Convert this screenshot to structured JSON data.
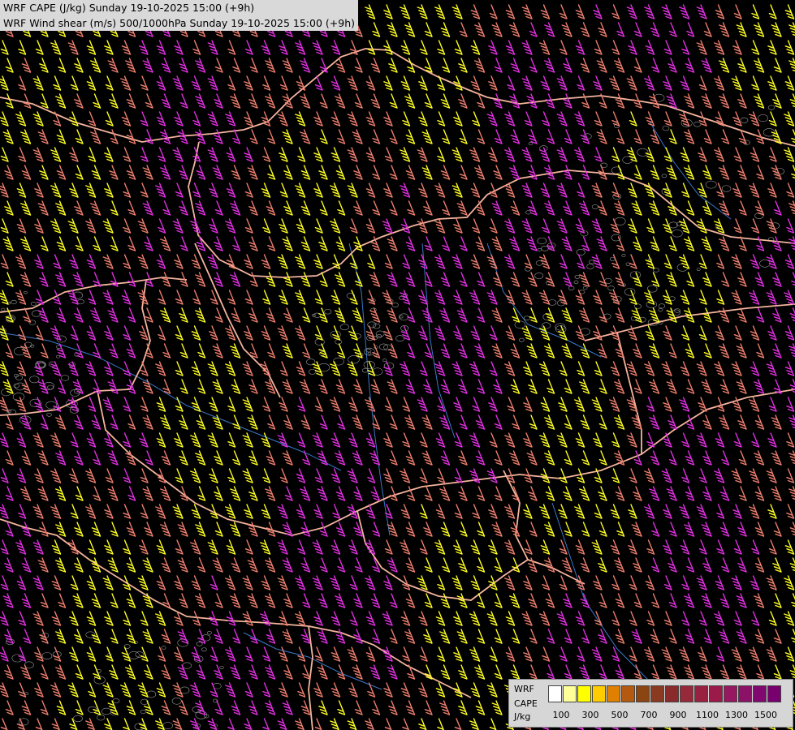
{
  "titles": {
    "cape": "WRF CAPE (J/kg) Sunday 19-10-2025 15:00 (+9h)",
    "shear": "WRF Wind shear (m/s) 500/1000hPa Sunday 19-10-2025 15:00 (+9h)"
  },
  "legend": {
    "line1": "WRF",
    "line2": "CAPE",
    "line3": "J/kg",
    "ticks": [
      "100",
      "300",
      "500",
      "700",
      "900",
      "1100",
      "1300",
      "1500"
    ],
    "swatch_colors": [
      "#ffffff",
      "#ffff99",
      "#ffff00",
      "#ffcc00",
      "#e08000",
      "#b35a10",
      "#8b4513",
      "#8a3a20",
      "#8b2a2a",
      "#962a3a",
      "#9a2040",
      "#9b1a4a",
      "#951860",
      "#8c1268",
      "#800870",
      "#78006e"
    ]
  },
  "colors": {
    "background": "#000000",
    "barb_low": "#ffff22",
    "barb_mid": "#ef7f6f",
    "barb_high": "#e430e4",
    "border": "#f4b49e",
    "river": "#3a78c8",
    "contour": "#c8c8c8"
  }
}
